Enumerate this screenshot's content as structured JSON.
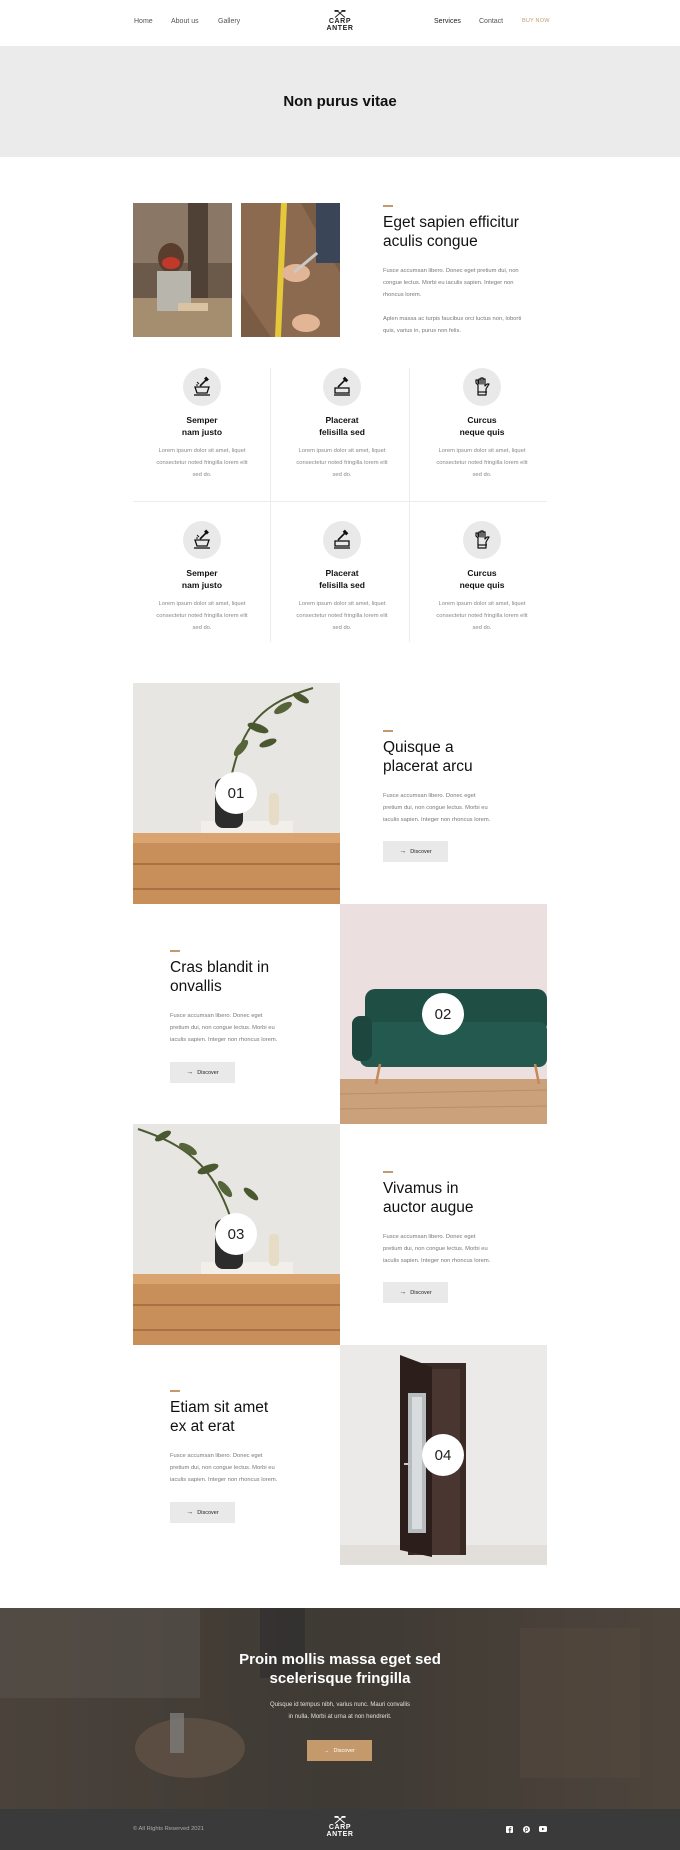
{
  "nav": {
    "left": [
      "Home",
      "About us",
      "Gallery"
    ],
    "right": [
      "Services",
      "Contact"
    ],
    "buy": "BUY NOW",
    "logo": [
      "CARP",
      "ANTER"
    ]
  },
  "hero": {
    "title": "Non purus vitae"
  },
  "intro": {
    "title_l1": "Eget sapien efficitur",
    "title_l2": "aculis congue",
    "p1": [
      "Fusce accumsan libero. Donec eget pretium dui, non",
      "congue lectus. Morbi eu iaculis sapien. Integer non",
      "rhoncus lorem."
    ],
    "p2": [
      "Aplen massa ac turpis faucibus orci luctus non, loborti",
      "quis, varius in, purus non felis."
    ]
  },
  "features": [
    {
      "icon": "mortar-pestle-icon",
      "title": [
        "Semper",
        "nam justo"
      ],
      "desc": [
        "Lorem ipsum dolor sit amet, liquet",
        "consectetur noted fringilla lorem elit",
        "sed do."
      ]
    },
    {
      "icon": "plane-tool-icon",
      "title": [
        "Placerat",
        "felisilla sed"
      ],
      "desc": [
        "Lorem ipsum dolor sit amet, liquet",
        "consectetur noted fringilla lorem elit",
        "sed do."
      ]
    },
    {
      "icon": "glove-icon",
      "title": [
        "Curcus",
        "neque quis"
      ],
      "desc": [
        "Lorem ipsum dolor sit amet, liquet",
        "consectetur noted fringilla lorem elit",
        "sed do."
      ]
    },
    {
      "icon": "mortar-pestle-icon",
      "title": [
        "Semper",
        "nam justo"
      ],
      "desc": [
        "Lorem ipsum dolor sit amet, liquet",
        "consectetur noted fringilla lorem elit",
        "sed do."
      ]
    },
    {
      "icon": "plane-tool-icon",
      "title": [
        "Placerat",
        "felisilla sed"
      ],
      "desc": [
        "Lorem ipsum dolor sit amet, liquet",
        "consectetur noted fringilla lorem elit",
        "sed do."
      ]
    },
    {
      "icon": "glove-icon",
      "title": [
        "Curcus",
        "neque quis"
      ],
      "desc": [
        "Lorem ipsum dolor sit amet, liquet",
        "consectetur noted fringilla lorem elit",
        "sed do."
      ]
    }
  ],
  "items": [
    {
      "num": "01",
      "title": [
        "Quisque a",
        "placerat arcu"
      ],
      "text": [
        "Fusce accumsan libero. Donec eget",
        "pretium dui, non congue lectus. Morbi eu",
        "iaculis sapien. Integer non rhoncus lorem."
      ],
      "button": "Discover"
    },
    {
      "num": "02",
      "title": [
        "Cras blandit in",
        "onvallis"
      ],
      "text": [
        "Fusce accumsan libero. Donec eget",
        "pretium dui, non congue lectus. Morbi eu",
        "iaculis sapien. Integer non rhoncus lorem."
      ],
      "button": "Discover"
    },
    {
      "num": "03",
      "title": [
        "Vivamus in",
        "auctor augue"
      ],
      "text": [
        "Fusce accumsan libero. Donec eget",
        "pretium dui, non congue lectus. Morbi eu",
        "iaculis sapien. Integer non rhoncus lorem."
      ],
      "button": "Discover"
    },
    {
      "num": "04",
      "title": [
        "Etiam sit amet",
        "ex at erat"
      ],
      "text": [
        "Fusce accumsan libero. Donec eget",
        "pretium dui, non congue lectus. Morbi eu",
        "iaculis sapien. Integer non rhoncus lorem."
      ],
      "button": "Discover"
    }
  ],
  "cta": {
    "title": [
      "Proin mollis massa eget sed",
      "scelerisque fringilla"
    ],
    "text": [
      "Quisque id tempus nibh, varius nunc. Mauri convallis",
      "in nulla. Morbi at urna at non hendrerit."
    ],
    "button": "Discover"
  },
  "footer": {
    "copyright": "© All Rights Reserved 2021",
    "logo": [
      "CARP",
      "ANTER"
    ],
    "social": [
      "facebook-icon",
      "pinterest-icon",
      "youtube-icon"
    ]
  },
  "colors": {
    "accent": "#c49a6c",
    "hero_bg": "#ebebeb",
    "footer_bg": "#3a3a3a",
    "button_bg": "#e9e9e9"
  }
}
